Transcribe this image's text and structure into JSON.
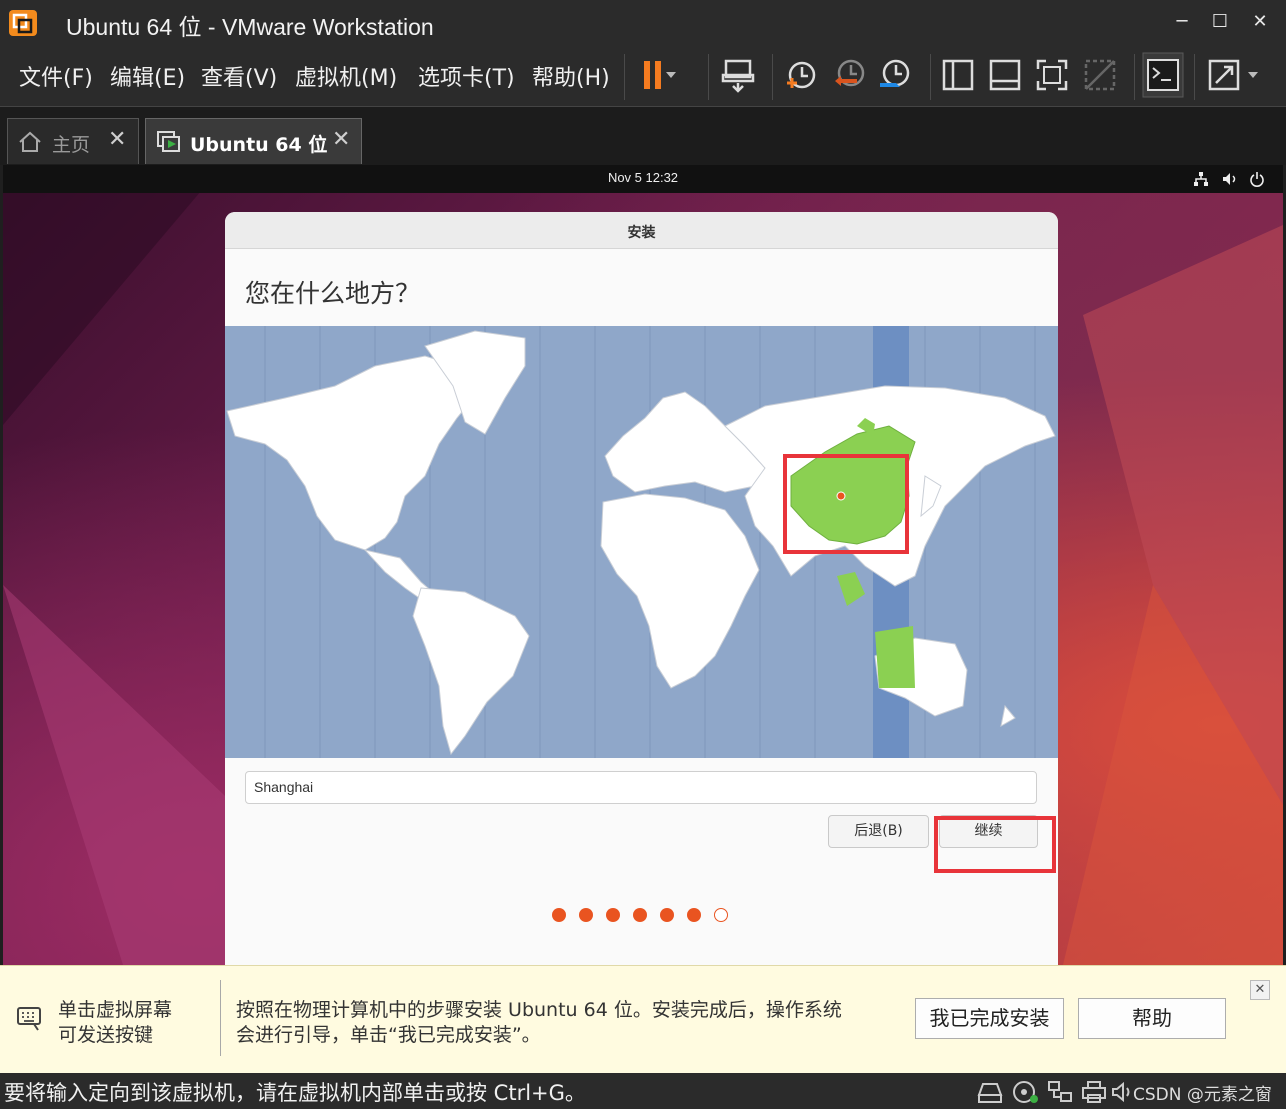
{
  "window": {
    "title": "Ubuntu 64 位 - VMware Workstation"
  },
  "menu": {
    "file": "文件(F)",
    "edit": "编辑(E)",
    "view": "查看(V)",
    "vm": "虚拟机(M)",
    "tabs": "选项卡(T)",
    "help": "帮助(H)"
  },
  "tabs": [
    {
      "label": "主页"
    },
    {
      "label": "Ubuntu 64 位"
    }
  ],
  "guest": {
    "clock": "Nov 5  12:32",
    "dialog_title": "安装",
    "heading": "您在什么地方？",
    "location_value": "Shanghai",
    "back_label": "后退(B)",
    "continue_label": "继续",
    "progress": {
      "total": 7,
      "completed": 6
    }
  },
  "notify": {
    "hint_line1": "单击虚拟屏幕",
    "hint_line2": "可发送按键",
    "message_line1": "按照在物理计算机中的步骤安装 Ubuntu 64 位。安装完成后，操作系统",
    "message_line2": "会进行引导，单击“我已完成安装”。",
    "done_label": "我已完成安装",
    "help_label": "帮助"
  },
  "status": {
    "text": "要将输入定向到该虚拟机，请在虚拟机内部单击或按 Ctrl+G。",
    "watermark": "CSDN @元素之窗"
  },
  "colors": {
    "accent": "#e95420",
    "highlight": "#e8343a",
    "timezone": "#8bc34a"
  }
}
